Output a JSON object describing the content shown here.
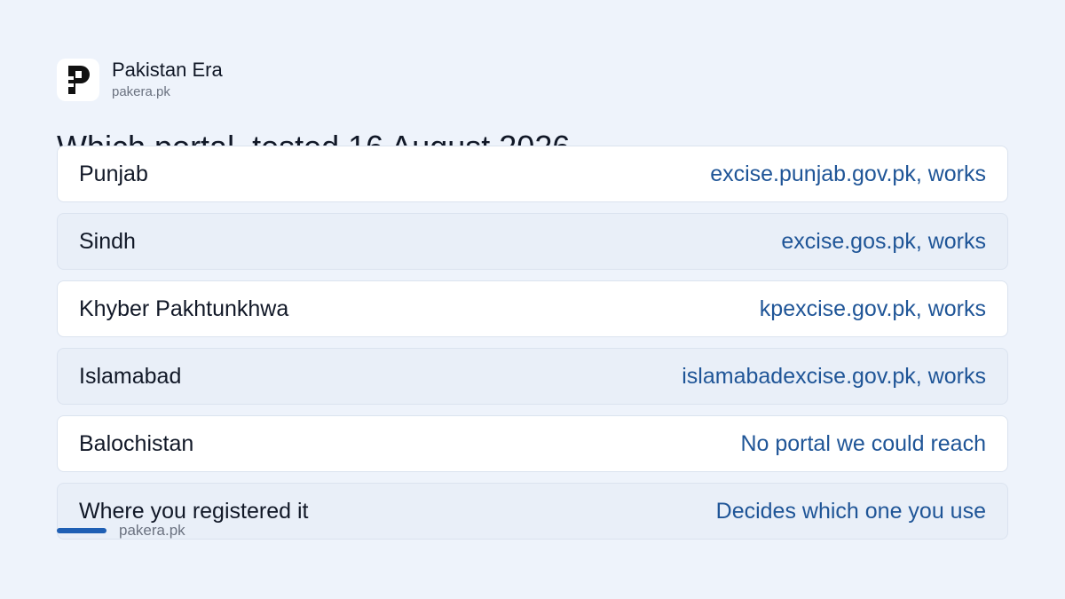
{
  "brand": {
    "name": "Pakistan Era",
    "url": "pakera.pk",
    "logo_icon": "pakera-logo-icon"
  },
  "headline": "Which portal, tested 16 August 2026",
  "rows": [
    {
      "label": "Punjab",
      "value": "excise.punjab.gov.pk, works"
    },
    {
      "label": "Sindh",
      "value": "excise.gos.pk, works"
    },
    {
      "label": "Khyber Pakhtunkhwa",
      "value": "kpexcise.gov.pk, works"
    },
    {
      "label": "Islamabad",
      "value": "islamabadexcise.gov.pk, works"
    },
    {
      "label": "Balochistan",
      "value": "No portal we could reach"
    },
    {
      "label": "Where you registered it",
      "value": "Decides which one you use"
    }
  ],
  "footer": {
    "url": "pakera.pk"
  },
  "colors": {
    "background": "#eef3fb",
    "accent": "#1f5fb4",
    "value_text": "#1f5597"
  }
}
